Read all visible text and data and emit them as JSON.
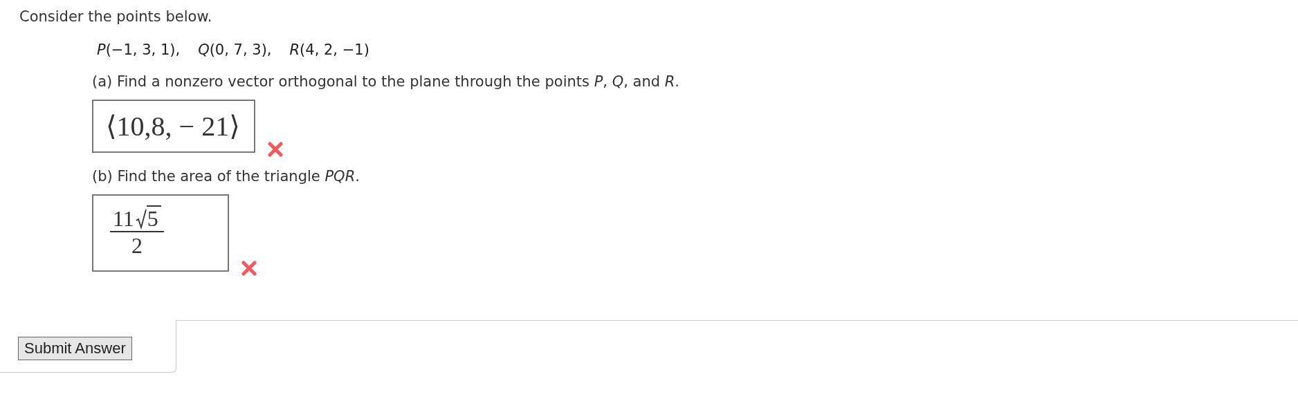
{
  "intro": "Consider the points below.",
  "points": [
    {
      "name": "P",
      "coords": "(−1, 3, 1),"
    },
    {
      "name": "Q",
      "coords": "(0, 7, 3),"
    },
    {
      "name": "R",
      "coords": "(4, 2, −1)"
    }
  ],
  "parts": [
    {
      "prompt": "(a) Find a nonzero vector orthogonal to the plane through the points *P*, *Q*, and *R*.",
      "answer": {
        "kind": "vector",
        "text": "⟨10,8, − 21⟩"
      },
      "correct": false
    },
    {
      "prompt": "(b) Find the area of the triangle *PQR*.",
      "answer": {
        "kind": "fraction",
        "numerator": "11",
        "radicand": "5",
        "denominator": "2"
      },
      "correct": false
    }
  ],
  "submit_button": "Submit Answer"
}
